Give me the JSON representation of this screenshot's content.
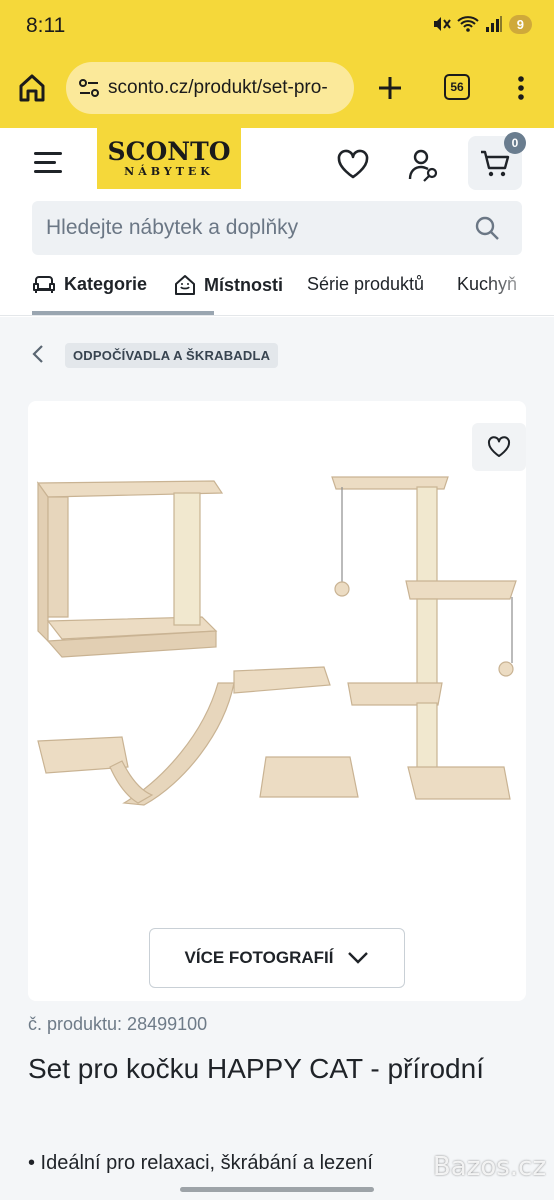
{
  "status_bar": {
    "time": "8:11",
    "battery": "9"
  },
  "browser": {
    "url": "sconto.cz/produkt/set-pro-",
    "tab_count": "56"
  },
  "header": {
    "logo_line1": "SCONTO",
    "logo_line2": "NÁBYTEK",
    "cart_count": "0",
    "colors": {
      "brand_yellow": "#f5d83a"
    }
  },
  "search": {
    "placeholder": "Hledejte nábytek a doplňky"
  },
  "nav": {
    "tabs": [
      {
        "label": "Kategorie",
        "icon": "sofa-icon"
      },
      {
        "label": "Místnosti",
        "icon": "house-icon"
      },
      {
        "label": "Série produktů"
      },
      {
        "label": "Kuchyň"
      }
    ]
  },
  "breadcrumb": {
    "label": "ODPOČÍVADLA A ŠKRABADLA"
  },
  "gallery": {
    "more_photos_label": "VÍCE FOTOGRAFIÍ"
  },
  "product": {
    "number_label": "č. produktu: 28499100",
    "title": "Set pro kočku HAPPY CAT - přírodní",
    "bullet": "• Ideální pro relaxaci, škrábání a lezení"
  },
  "watermark": "Bazos.cz"
}
